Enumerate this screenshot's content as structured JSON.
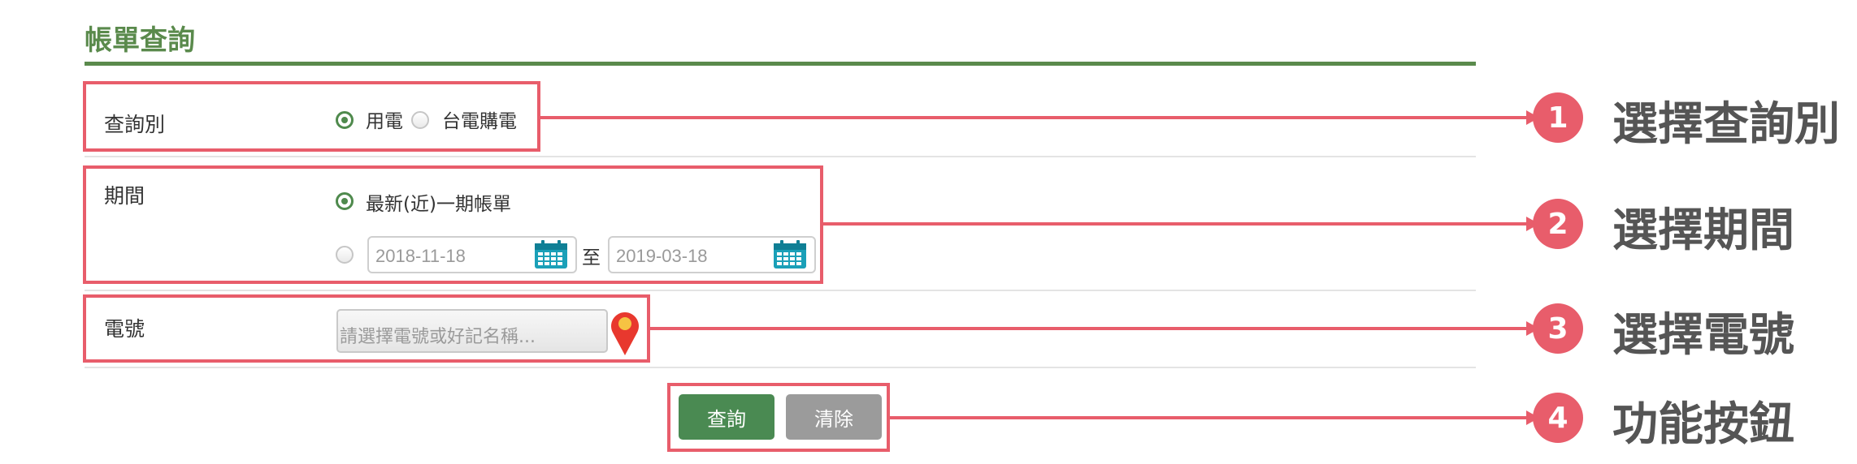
{
  "page_title": "帳單查詢",
  "query_type": {
    "label": "查詢別",
    "options": [
      {
        "label": "用電",
        "selected": true
      },
      {
        "label": "台電購電",
        "selected": false
      }
    ]
  },
  "period": {
    "label": "期間",
    "latest_option": {
      "label": "最新(近)一期帳單",
      "selected": true
    },
    "range_option": {
      "selected": false
    },
    "start_date": "2018-11-18",
    "to_label": "至",
    "end_date": "2019-03-18"
  },
  "number": {
    "label": "電號",
    "placeholder": "請選擇電號或好記名稱..."
  },
  "buttons": {
    "query": "查詢",
    "clear": "清除"
  },
  "annotations": [
    {
      "num": "1",
      "text": "選擇查詢別"
    },
    {
      "num": "2",
      "text": "選擇期間"
    },
    {
      "num": "3",
      "text": "選擇電號"
    },
    {
      "num": "4",
      "text": "功能按鈕"
    }
  ],
  "colors": {
    "accent_green": "#5a8a4c",
    "button_green": "#4a8a52",
    "button_gray": "#9b9b9b",
    "annotation_red": "#e85d6b",
    "calendar_teal": "#1aa0b8"
  }
}
